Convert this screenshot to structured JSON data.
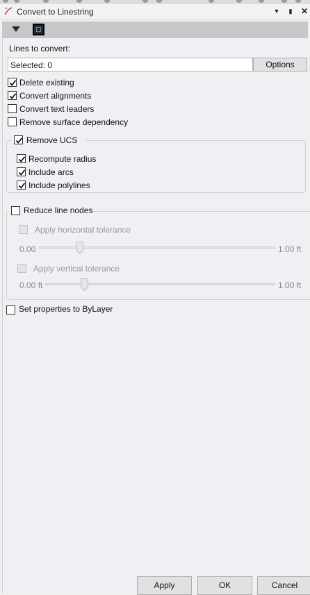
{
  "window": {
    "title": "Convert to Linestring",
    "dropdown_icon": "dropdown-arrow-icon",
    "pin_icon": "pin-icon",
    "close_icon": "close-icon"
  },
  "panel": {
    "collapse_icon": "collapse-triangle-icon",
    "preview_icon": "preview-image-icon"
  },
  "lines": {
    "label": "Lines to convert:",
    "selected_value": "Selected: 0",
    "options_label": "Options"
  },
  "checkboxes": {
    "delete_existing": {
      "label": "Delete existing",
      "checked": true
    },
    "convert_alignments": {
      "label": "Convert alignments",
      "checked": true
    },
    "convert_text_leaders": {
      "label": "Convert text leaders",
      "checked": false
    },
    "remove_surface_dependency": {
      "label": "Remove surface dependency",
      "checked": false
    },
    "set_properties_bylayer": {
      "label": "Set properties to ByLayer",
      "checked": false
    }
  },
  "remove_ucs": {
    "label": "Remove UCS",
    "checked": true,
    "recompute_radius": {
      "label": "Recompute radius",
      "checked": true
    },
    "include_arcs": {
      "label": "Include arcs",
      "checked": true
    },
    "include_polylines": {
      "label": "Include polylines",
      "checked": true
    }
  },
  "reduce_nodes": {
    "label": "Reduce line nodes",
    "checked": false,
    "horizontal": {
      "label": "Apply horizontal tolerance",
      "checked": false,
      "min": "0.00",
      "max": "1.00 ft",
      "value_fraction": 0.17
    },
    "vertical": {
      "label": "Apply vertical tolerance",
      "checked": false,
      "min": "0.00 ft",
      "max": "1.00 ft",
      "value_fraction": 0.17
    }
  },
  "footer": {
    "apply_label": "Apply",
    "ok_label": "OK",
    "cancel_label": "Cancel"
  },
  "colors": {
    "panel_bg": "#f0f0f4",
    "titlebar_bg": "#f3f3f3",
    "panelbar_bg": "#c8c8cb",
    "button_bg": "#e1e1e1",
    "disabled_text": "#999999"
  }
}
